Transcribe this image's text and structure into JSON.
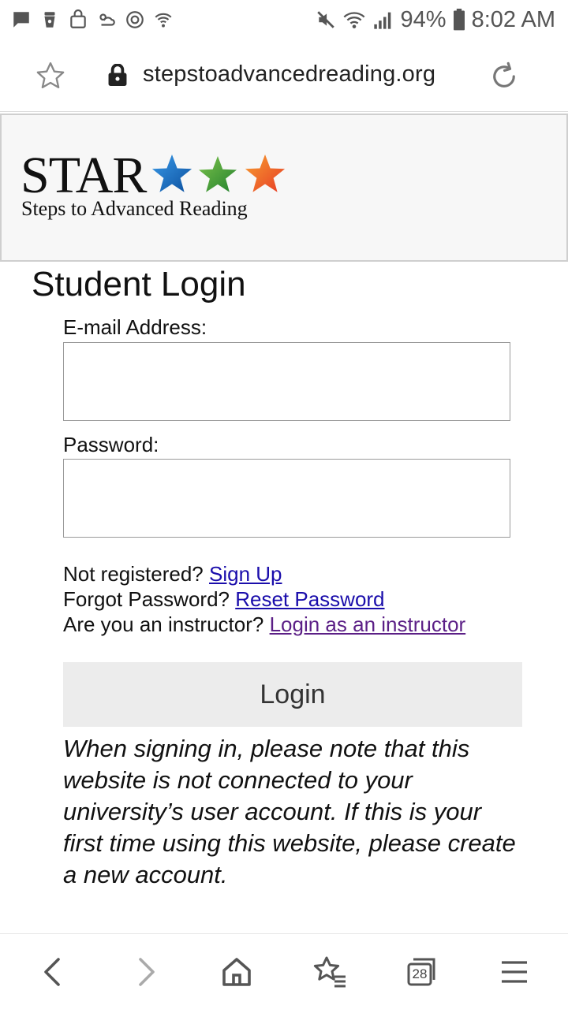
{
  "status_bar": {
    "battery_percent": "94%",
    "time": "8:02 AM",
    "left_icons": [
      "message-icon",
      "coffee-icon",
      "bag-icon",
      "weather-icon",
      "sync-icon",
      "wifi-call-icon"
    ],
    "right_icons": [
      "mute-icon",
      "wifi-icon",
      "signal-icon",
      "battery-icon"
    ]
  },
  "browser": {
    "url": "stepstoadvancedreading.org",
    "tab_count": "28"
  },
  "banner": {
    "logo_text": "STAR",
    "tagline": "Steps to Advanced Reading",
    "star_colors": [
      "#1a72c9",
      "#4aa63a",
      "#f0622a"
    ]
  },
  "login": {
    "title": "Student Login",
    "email_label": "E-mail Address:",
    "email_value": "",
    "password_label": "Password:",
    "password_value": "",
    "not_registered": "Not registered?",
    "sign_up": "Sign Up",
    "forgot_password": "Forgot Password?",
    "reset_password": "Reset Password",
    "instructor_question": "Are you an instructor?",
    "instructor_link": "Login as an instructor",
    "login_button": "Login",
    "note": "When signing in, please note that this website is not connected to your university’s user account. If this is your first time using this website, please create a new account."
  }
}
